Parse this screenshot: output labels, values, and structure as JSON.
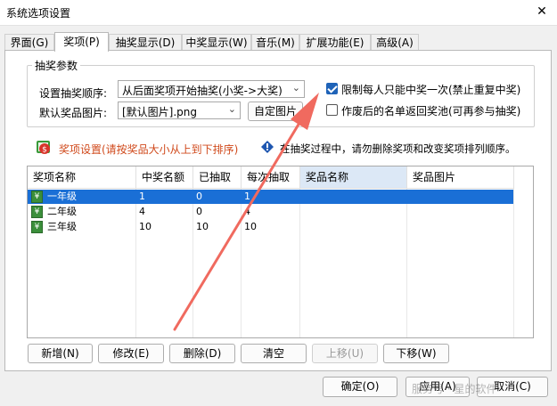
{
  "window": {
    "title": "系统选项设置",
    "close_glyph": "✕"
  },
  "tabs": [
    {
      "label": "界面(G)"
    },
    {
      "label": "奖项(P)"
    },
    {
      "label": "抽奖显示(D)"
    },
    {
      "label": "中奖显示(W)"
    },
    {
      "label": "音乐(M)"
    },
    {
      "label": "扩展功能(E)"
    },
    {
      "label": "高级(A)"
    }
  ],
  "draw_params": {
    "group_title": "抽奖参数",
    "order_label": "设置抽奖顺序:",
    "order_value": "从后面奖项开始抽奖(小奖->大奖)",
    "image_label": "默认奖品图片:",
    "image_value": "[默认图片].png",
    "custom_image_button": "自定图片",
    "limit_once_label": "限制每人只能中奖一次(禁止重复中奖)",
    "limit_once_checked": true,
    "return_pool_label": "作废后的名单返回奖池(可再参与抽奖)",
    "return_pool_checked": false
  },
  "prize_section": {
    "title": "奖项设置(请按奖品大小从上到下排序)",
    "title_color": "#d04a1c",
    "notice": "在抽奖过程中，请勿删除奖项和改变奖项排列顺序。"
  },
  "table": {
    "columns": [
      "奖项名称",
      "中奖名额",
      "已抽取",
      "每次抽取",
      "奖品名称",
      "奖品图片"
    ],
    "rows": [
      {
        "name": "一年级",
        "quota": "1",
        "drawn": "0",
        "per_draw": "1",
        "prize": "",
        "image": "",
        "selected": true
      },
      {
        "name": "二年级",
        "quota": "4",
        "drawn": "0",
        "per_draw": "4",
        "prize": "",
        "image": "",
        "selected": false
      },
      {
        "name": "三年级",
        "quota": "10",
        "drawn": "10",
        "per_draw": "10",
        "prize": "",
        "image": "",
        "selected": false
      }
    ]
  },
  "row_buttons": {
    "add": "新增(N)",
    "edit": "修改(E)",
    "delete": "删除(D)",
    "clear": "清空",
    "move_up": "上移(U)",
    "move_down": "下移(W)"
  },
  "footer": {
    "ok": "确定(O)",
    "apply": "应用(A)",
    "cancel": "取消(C)",
    "watermark": "服务号 · 星的软件"
  },
  "colors": {
    "selected_row": "#1a6fd6",
    "arrow": "#f06a5f",
    "checkbox_checked": "#1f63b8"
  }
}
